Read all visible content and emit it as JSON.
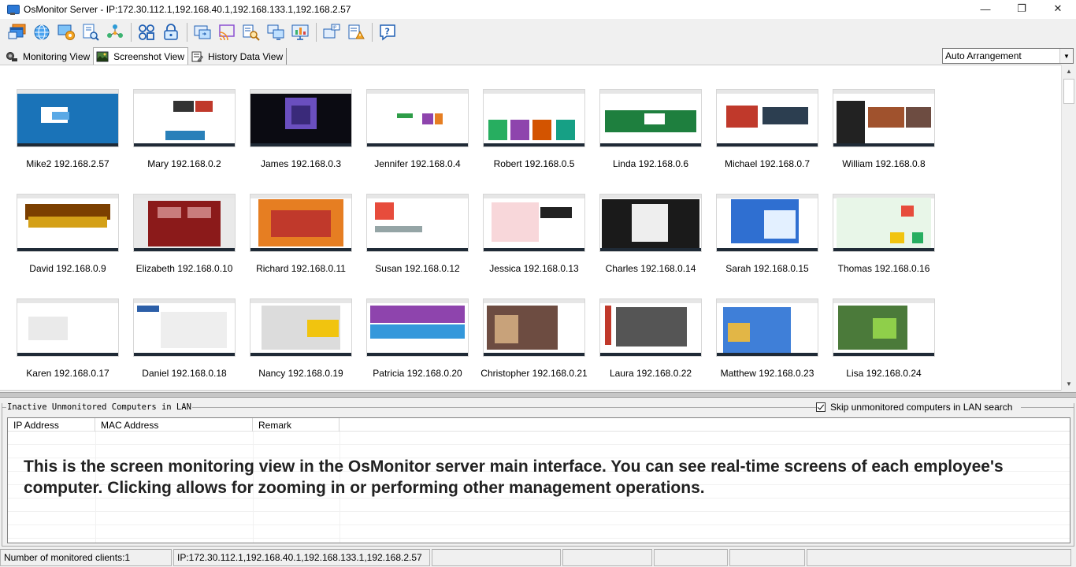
{
  "window": {
    "title": "OsMonitor Server - IP:172.30.112.1,192.168.40.1,192.168.133.1,192.168.2.57",
    "minimize": "—",
    "restore": "❐",
    "close": "✕"
  },
  "toolbar": {
    "buttons": [
      {
        "icon": "windows-stack-icon"
      },
      {
        "icon": "globe-icon"
      },
      {
        "icon": "settings-computer-icon"
      },
      {
        "icon": "report-search-icon"
      },
      {
        "icon": "network-users-icon"
      },
      {
        "icon": "group-nodes-icon"
      },
      {
        "icon": "lock-computer-icon"
      },
      {
        "icon": "remote-desktop-icon"
      },
      {
        "icon": "screen-cast-icon"
      },
      {
        "icon": "search-list-icon"
      },
      {
        "icon": "multi-monitor-icon"
      },
      {
        "icon": "monitor-chart-icon"
      },
      {
        "icon": "ip-computer-icon"
      },
      {
        "icon": "alert-document-icon"
      },
      {
        "icon": "help-icon"
      }
    ]
  },
  "tabs": [
    {
      "label": "Monitoring View"
    },
    {
      "label": "Screenshot View"
    },
    {
      "label": "History Data View"
    }
  ],
  "arrangement": {
    "value": "Auto Arrangement"
  },
  "clients": [
    {
      "caption": "Mike2 192.168.2.57"
    },
    {
      "caption": "Mary 192.168.0.2"
    },
    {
      "caption": "James 192.168.0.3"
    },
    {
      "caption": "Jennifer 192.168.0.4"
    },
    {
      "caption": "Robert 192.168.0.5"
    },
    {
      "caption": "Linda 192.168.0.6"
    },
    {
      "caption": "Michael 192.168.0.7"
    },
    {
      "caption": "William 192.168.0.8"
    },
    {
      "caption": "David 192.168.0.9"
    },
    {
      "caption": "Elizabeth 192.168.0.10"
    },
    {
      "caption": "Richard 192.168.0.11"
    },
    {
      "caption": "Susan 192.168.0.12"
    },
    {
      "caption": "Jessica 192.168.0.13"
    },
    {
      "caption": "Charles 192.168.0.14"
    },
    {
      "caption": "Sarah 192.168.0.15"
    },
    {
      "caption": "Thomas 192.168.0.16"
    },
    {
      "caption": "Karen 192.168.0.17"
    },
    {
      "caption": "Daniel 192.168.0.18"
    },
    {
      "caption": "Nancy 192.168.0.19"
    },
    {
      "caption": "Patricia 192.168.0.20"
    },
    {
      "caption": "Christopher 192.168.0.21"
    },
    {
      "caption": "Laura 192.168.0.22"
    },
    {
      "caption": "Matthew 192.168.0.23"
    },
    {
      "caption": "Lisa 192.168.0.24"
    }
  ],
  "inactive": {
    "title": "Inactive Unmonitored Computers in LAN",
    "skip_label": "Skip unmonitored computers in LAN search",
    "columns": [
      "IP Address",
      "MAC Address",
      "Remark"
    ],
    "overlay": "This is the screen monitoring view in the OsMonitor server main interface. You can see real-time screens of each employee's computer. Clicking allows for zooming in or performing other management operations."
  },
  "status": {
    "clients": "Number of monitored clients:1",
    "ips": "IP:172.30.112.1,192.168.40.1,192.168.133.1,192.168.2.57"
  },
  "colors": {
    "thumb_primary": [
      "#1a73b8",
      "#ffffff",
      "#0b0b12",
      "#ffffff",
      "#ffffff",
      "#ffffff",
      "#ffffff",
      "#ffffff",
      "#ffffff",
      "#e9e9e9",
      "#ffffff",
      "#ffffff",
      "#ffffff",
      "#ffffff",
      "#ffffff",
      "#ffffff",
      "#ffffff",
      "#ffffff",
      "#ffffff",
      "#ffffff",
      "#ffffff",
      "#ffffff",
      "#ffffff",
      "#ffffff"
    ]
  }
}
